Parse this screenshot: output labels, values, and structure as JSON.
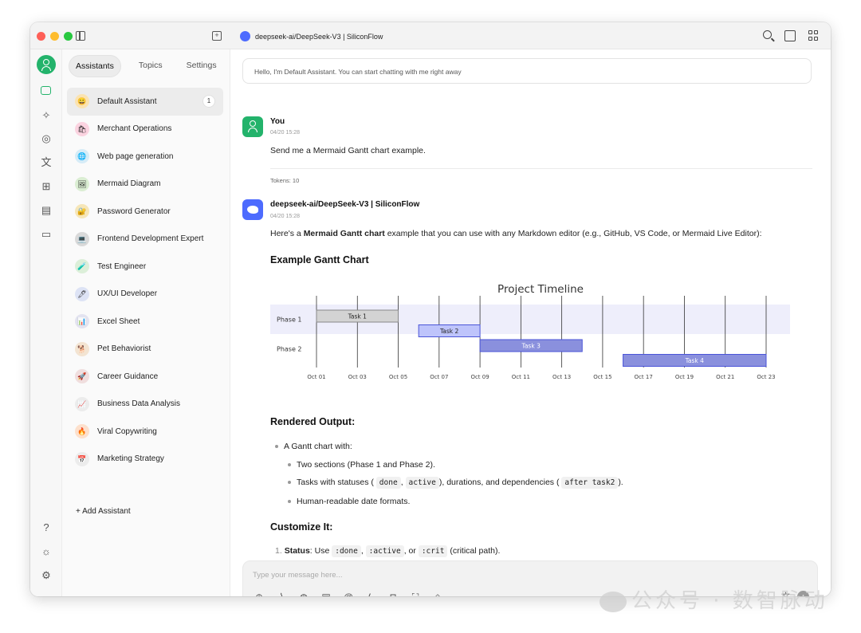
{
  "window": {
    "title": "deepseek-ai/DeepSeek-V3 | SiliconFlow",
    "traffic_lights": [
      "#fe5f57",
      "#febc2e",
      "#28c840"
    ]
  },
  "sidebar": {
    "tabs": [
      {
        "label": "Assistants",
        "active": true
      },
      {
        "label": "Topics",
        "active": false
      },
      {
        "label": "Settings",
        "active": false
      }
    ],
    "assistants": [
      {
        "name": "Default Assistant",
        "emoji": "😀",
        "bg": "#fbe3b0",
        "badge": "1",
        "active": true
      },
      {
        "name": "Merchant Operations",
        "emoji": "🛍",
        "bg": "#fbd3e0"
      },
      {
        "name": "Web page generation",
        "emoji": "🌐",
        "bg": "#d6ecf7"
      },
      {
        "name": "Mermaid Diagram",
        "emoji": "🖼",
        "bg": "#dbeed3"
      },
      {
        "name": "Password Generator",
        "emoji": "🔐",
        "bg": "#f6e6b8"
      },
      {
        "name": "Frontend Development Expert",
        "emoji": "💻",
        "bg": "#d9d9d9"
      },
      {
        "name": "Test Engineer",
        "emoji": "🧪",
        "bg": "#dcefd9"
      },
      {
        "name": "UX/UI Developer",
        "emoji": "🖊",
        "bg": "#dde3f5"
      },
      {
        "name": "Excel Sheet",
        "emoji": "📊",
        "bg": "#e3e3f0"
      },
      {
        "name": "Pet Behaviorist",
        "emoji": "🐕",
        "bg": "#f3e4d2"
      },
      {
        "name": "Career Guidance",
        "emoji": "🚀",
        "bg": "#f0dede"
      },
      {
        "name": "Business Data Analysis",
        "emoji": "📈",
        "bg": "#ececec"
      },
      {
        "name": "Viral Copywriting",
        "emoji": "🔥",
        "bg": "#fde0cc"
      },
      {
        "name": "Marketing Strategy",
        "emoji": "📅",
        "bg": "#ececec"
      }
    ],
    "add_assistant": "+ Add Assistant"
  },
  "chat": {
    "system_prompt": "Hello, I'm Default Assistant. You can start chatting with me right away",
    "user": {
      "name": "You",
      "time": "04/20 15:28",
      "text": "Send me a Mermaid Gantt chart example.",
      "tokens": "Tokens: 10"
    },
    "assistant": {
      "name": "deepseek-ai/DeepSeek-V3 | SiliconFlow",
      "time": "04/20 15:28",
      "intro_before": "Here's a ",
      "intro_bold": "Mermaid Gantt chart",
      "intro_after": " example that you can use with any Markdown editor (e.g., GitHub, VS Code, or Mermaid Live Editor):",
      "heading_example": "Example Gantt Chart",
      "heading_rendered": "Rendered Output:",
      "bullet_main": "A Gantt chart with:",
      "sub1": "Two sections (Phase 1 and Phase 2).",
      "sub2_a": "Tasks with statuses (",
      "sub2_code1": "done",
      "sub2_comma": ",",
      "sub2_code2": "active",
      "sub2_b": "), durations, and dependencies (",
      "sub2_code3": "after task2",
      "sub2_c": ").",
      "sub3": "Human-readable date formats.",
      "heading_customize": "Customize It:",
      "num1_prefix": "1.",
      "num1_bold": "Status",
      "num1_a": ": Use",
      "num1_code1": ":done",
      "num1_code2": ":active",
      "num1_or": ", or",
      "num1_code3": ":crit",
      "num1_b": "(critical path)."
    }
  },
  "chart_data": {
    "type": "gantt",
    "title": "Project Timeline",
    "x_ticks": [
      "Oct 01",
      "Oct 03",
      "Oct 05",
      "Oct 07",
      "Oct 09",
      "Oct 11",
      "Oct 13",
      "Oct 15",
      "Oct 17",
      "Oct 19",
      "Oct 21",
      "Oct 23"
    ],
    "x_range": [
      "2024-10-01",
      "2024-10-23"
    ],
    "sections": [
      "Phase 1",
      "Phase 2"
    ],
    "tasks": [
      {
        "name": "Task 1",
        "section": "Phase 1",
        "start": "2024-10-01",
        "end": "2024-10-05",
        "status": "done",
        "color": "#d3d3d3"
      },
      {
        "name": "Task 2",
        "section": "Phase 1",
        "start": "2024-10-06",
        "end": "2024-10-09",
        "status": "active",
        "color": "#bec4fb"
      },
      {
        "name": "Task 3",
        "section": "Phase 2",
        "start": "2024-10-09",
        "end": "2024-10-14",
        "status": "normal",
        "color": "#8a90dd"
      },
      {
        "name": "Task 4",
        "section": "Phase 2",
        "start": "2024-10-16",
        "end": "2024-10-23",
        "status": "normal",
        "color": "#8a90dd"
      }
    ]
  },
  "input": {
    "placeholder": "Type your message here..."
  },
  "watermark": "公众号 · 数智脉动"
}
